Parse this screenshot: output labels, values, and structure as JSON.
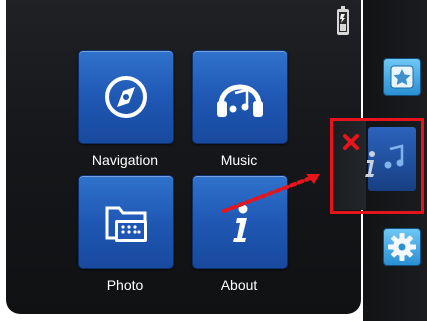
{
  "tiles": [
    {
      "label": "Navigation",
      "icon": "compass-icon"
    },
    {
      "label": "Music",
      "icon": "headphones-icon"
    },
    {
      "label": "Photo",
      "icon": "photo-folder-icon"
    },
    {
      "label": "About",
      "icon": "info-icon"
    }
  ],
  "status_bar": {
    "icon": "battery-charging-icon"
  },
  "side_panel": {
    "items": [
      {
        "name": "favorites-button",
        "icon": "star-icon"
      },
      {
        "name": "music-shortcut",
        "icon": "music-note-icon"
      },
      {
        "name": "settings-button",
        "icon": "gear-icon"
      }
    ]
  },
  "annotation": {
    "highlight_color": "#e8141c",
    "close_icon": "close-x-icon"
  },
  "colors": {
    "tile_blue": "#1e56b2",
    "background": "#15171a",
    "accent_cyan": "#6ec8f5"
  }
}
